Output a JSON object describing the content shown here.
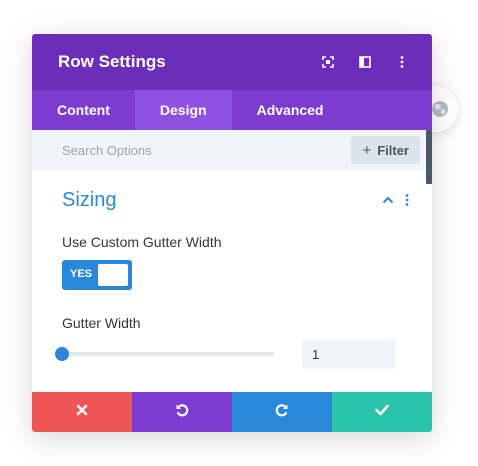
{
  "modal": {
    "title": "Row Settings",
    "header_icons": [
      "fullscreen-icon",
      "sidebar-dock-icon",
      "more-vertical-icon"
    ]
  },
  "tabs": [
    {
      "label": "Content",
      "active": false
    },
    {
      "label": "Design",
      "active": true
    },
    {
      "label": "Advanced",
      "active": false
    }
  ],
  "search": {
    "placeholder": "Search Options",
    "value": ""
  },
  "filter": {
    "label": "Filter",
    "icon": "plus-icon"
  },
  "section": {
    "title": "Sizing",
    "expanded": true
  },
  "custom_gutter": {
    "label": "Use Custom Gutter Width",
    "toggle_text": "YES",
    "enabled": true
  },
  "gutter_width": {
    "label": "Gutter Width",
    "value": "1",
    "slider_fraction": 0.0
  },
  "footer": {
    "buttons": [
      {
        "name": "discard",
        "icon": "close-icon",
        "color": "#ef5555"
      },
      {
        "name": "undo",
        "icon": "undo-icon",
        "color": "#7d3bcf"
      },
      {
        "name": "redo",
        "icon": "redo-icon",
        "color": "#2b87da"
      },
      {
        "name": "save",
        "icon": "check-icon",
        "color": "#29c4a9"
      }
    ]
  },
  "colors": {
    "header": "#6c2eb9",
    "tabs": "#7d3bcf",
    "tab_active": "#8f51e2",
    "accent_blue": "#2b87da"
  }
}
